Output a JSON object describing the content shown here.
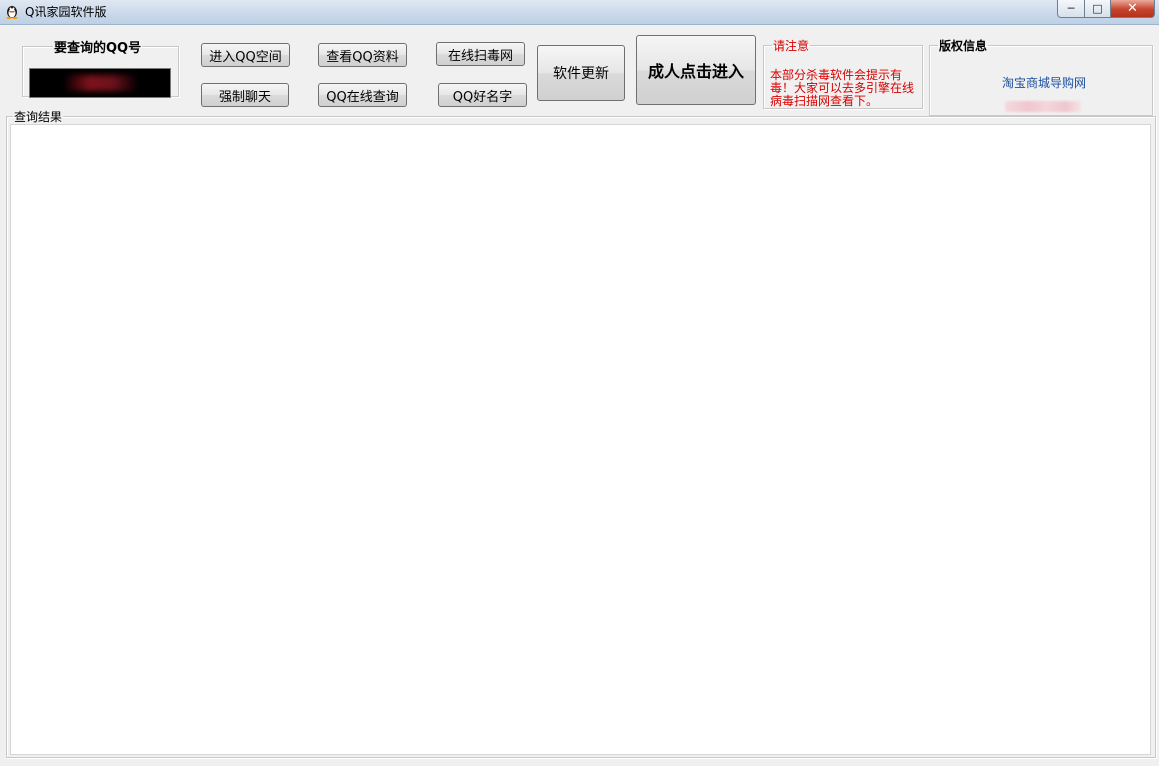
{
  "window": {
    "title": "Q讯家园软件版",
    "controls": {
      "minimize": "─",
      "maximize": "□",
      "close": "✕"
    }
  },
  "query_group": {
    "legend": "要查询的QQ号",
    "qq_value": ""
  },
  "buttons": {
    "enter_qzone": "进入QQ空间",
    "force_chat": "强制聊天",
    "view_profile": "查看QQ资料",
    "online_query": "QQ在线查询",
    "online_scan": "在线扫毒网",
    "good_name": "QQ好名字",
    "software_update": "软件更新",
    "adult_enter": "成人点击进入"
  },
  "notice": {
    "legend": "请注意",
    "text": "本部分杀毒软件会提示有毒！大家可以去多引擎在线病毒扫描网查看下。",
    "color": "#d80000"
  },
  "copyright": {
    "legend": "版权信息",
    "link": "淘宝商城导购网"
  },
  "results": {
    "legend": "查询结果"
  }
}
